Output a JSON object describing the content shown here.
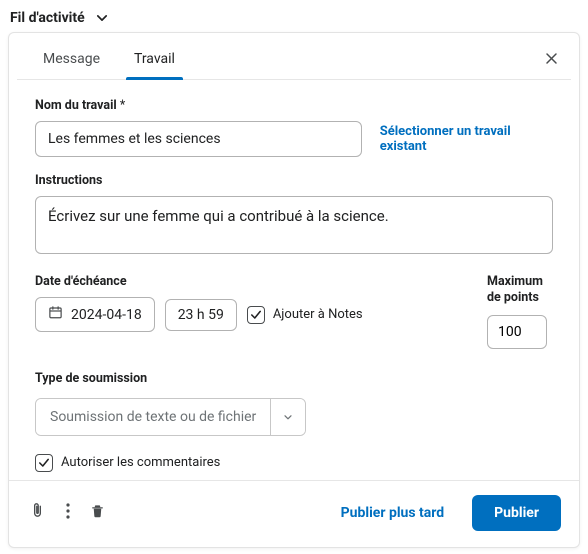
{
  "header": {
    "title": "Fil d'activité"
  },
  "tabs": {
    "message": "Message",
    "work": "Travail"
  },
  "name": {
    "label": "Nom du travail",
    "required_mark": "*",
    "value": "Les femmes et les sciences",
    "select_existing": "Sélectionner un travail existant"
  },
  "instructions": {
    "label": "Instructions",
    "value": "Écrivez sur une femme qui a contribué à la science."
  },
  "due": {
    "label": "Date d'échéance",
    "date": "2024-04-18",
    "time": "23 h 59",
    "add_to_notes": "Ajouter à Notes"
  },
  "points": {
    "label_line1": "Maximum",
    "label_line2": "de points",
    "value": "100"
  },
  "submission": {
    "label": "Type de soumission",
    "value": "Soumission de texte ou de fichier"
  },
  "allow_comments": "Autoriser les commentaires",
  "footer": {
    "later": "Publier plus tard",
    "publish": "Publier"
  }
}
